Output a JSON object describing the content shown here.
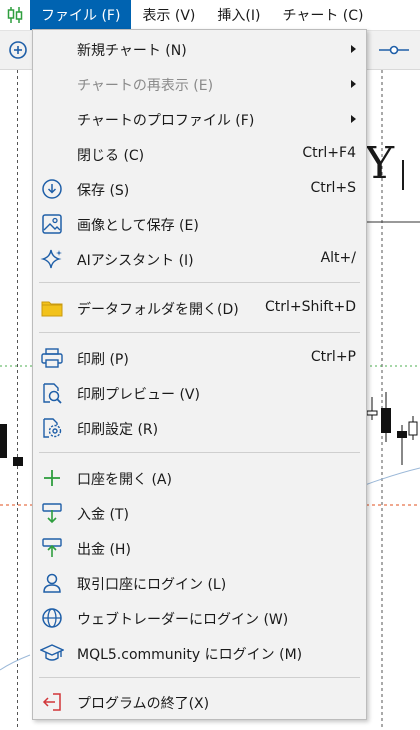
{
  "menubar": {
    "items": [
      {
        "label": "ファイル (F)",
        "active": true
      },
      {
        "label": "表示 (V)"
      },
      {
        "label": "挿入(I)"
      },
      {
        "label": "チャート (C)"
      }
    ]
  },
  "chart": {
    "title_fragment": "Y"
  },
  "file_menu": {
    "items": [
      {
        "label": "新規チャート (N)",
        "submenu": true
      },
      {
        "label": "チャートの再表示 (E)",
        "submenu": true,
        "disabled": true
      },
      {
        "label": "チャートのプロファイル (F)",
        "submenu": true
      },
      {
        "label": "閉じる (C)",
        "shortcut": "Ctrl+F4"
      },
      {
        "label": "保存 (S)",
        "shortcut": "Ctrl+S",
        "icon": "save-icon"
      },
      {
        "label": "画像として保存 (E)",
        "icon": "image-icon"
      },
      {
        "label": "AIアシスタント (I)",
        "shortcut": "Alt+/",
        "icon": "ai-sparkle-icon"
      },
      {
        "label": "データフォルダを開く(D)",
        "shortcut": "Ctrl+Shift+D",
        "icon": "folder-icon"
      },
      {
        "label": "印刷 (P)",
        "shortcut": "Ctrl+P",
        "icon": "printer-icon"
      },
      {
        "label": "印刷プレビュー (V)",
        "icon": "print-preview-icon"
      },
      {
        "label": "印刷設定 (R)",
        "icon": "print-settings-icon"
      },
      {
        "label": "口座を開く (A)",
        "icon": "plus-icon"
      },
      {
        "label": "入金 (T)",
        "icon": "deposit-icon"
      },
      {
        "label": "出金 (H)",
        "icon": "withdraw-icon"
      },
      {
        "label": "取引口座にログイン (L)",
        "icon": "user-icon"
      },
      {
        "label": "ウェブトレーダーにログイン (W)",
        "icon": "globe-icon"
      },
      {
        "label": "MQL5.community にログイン (M)",
        "icon": "graduation-cap-icon"
      },
      {
        "label": "プログラムの終了(X)",
        "icon": "exit-icon"
      }
    ]
  },
  "colors": {
    "accent": "#0063b1",
    "menu_bg": "#f2f2f2",
    "icon_blue": "#1f5fa8",
    "icon_green": "#2e9e3e",
    "exit_red": "#d13438",
    "folder_yellow": "#f2c21b"
  }
}
